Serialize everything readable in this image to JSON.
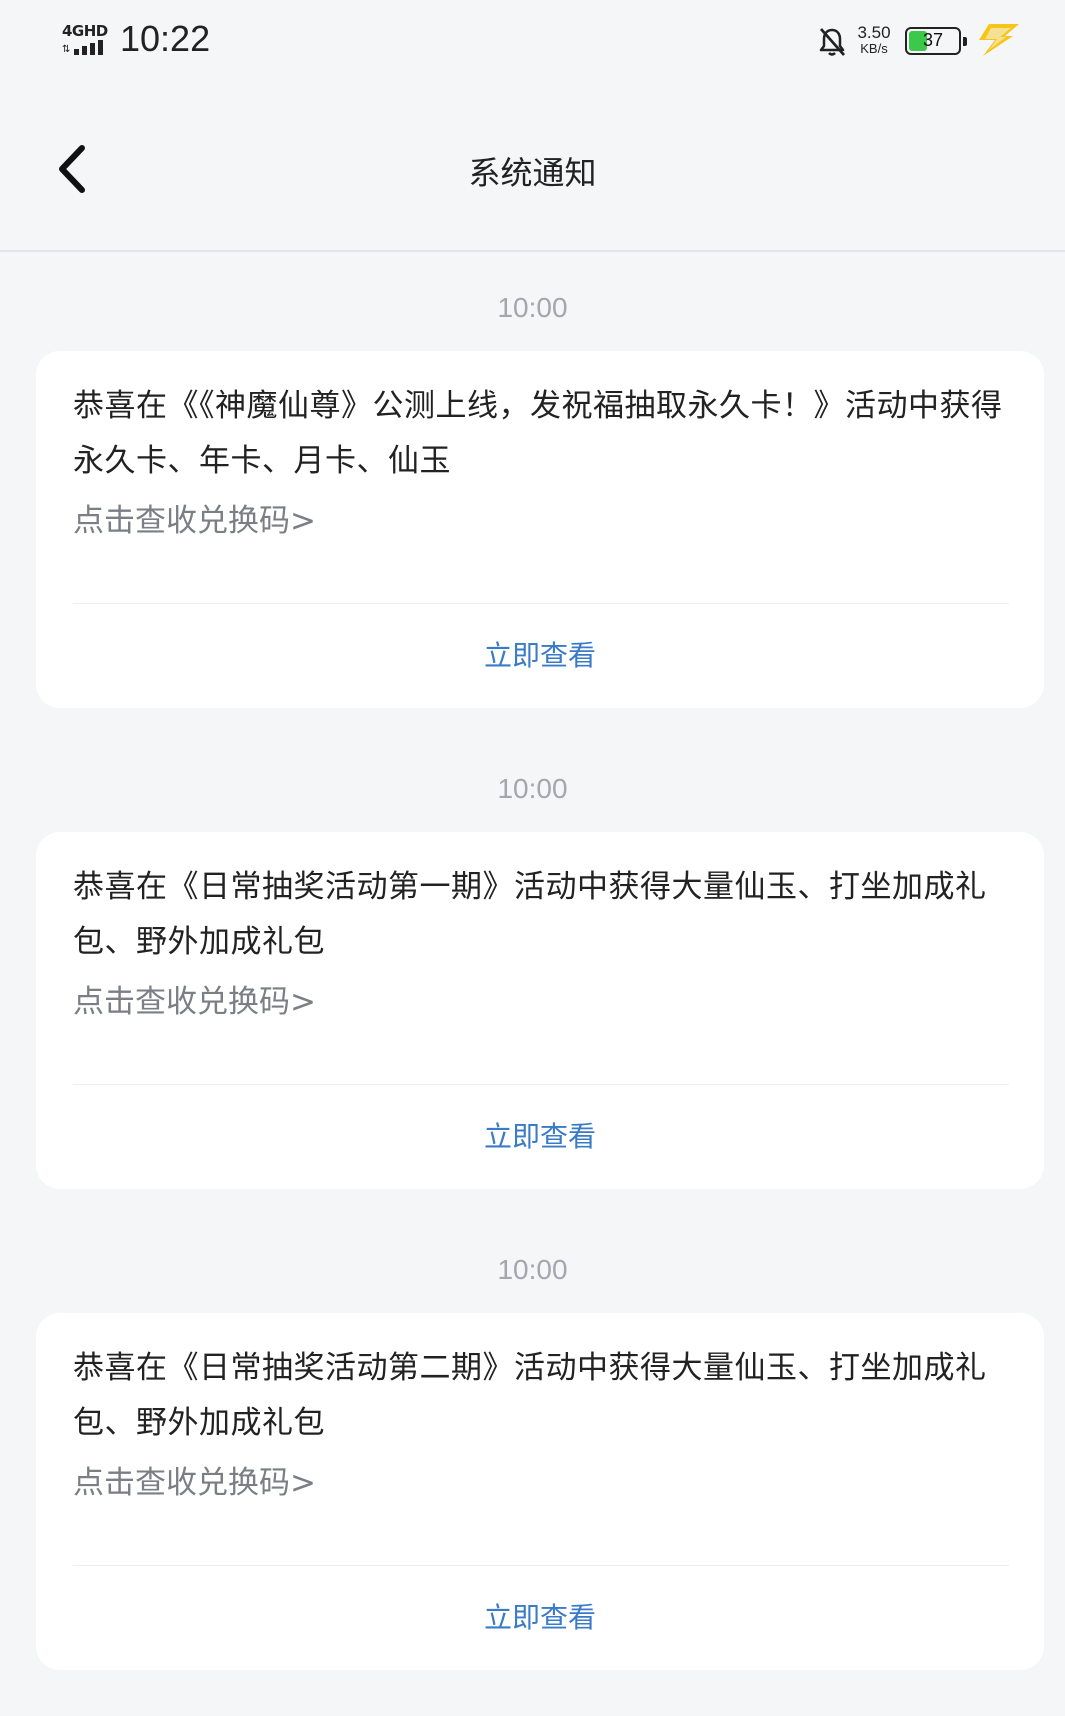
{
  "status_bar": {
    "network": "4GHD",
    "time": "10:22",
    "net_speed_value": "3.50",
    "net_speed_unit": "KB/s",
    "battery_level": "37",
    "battery_color": "#3cc84a",
    "charge_color": "#f5c518",
    "icons": [
      "signal-icon",
      "bell-off-icon",
      "battery-icon",
      "charging-icon"
    ]
  },
  "header": {
    "title": "系统通知",
    "back_icon": "chevron-left-icon"
  },
  "messages": [
    {
      "time": "10:00",
      "text": "恭喜在《《神魔仙尊》公测上线，发祝福抽取永久卡！》活动中获得永久卡、年卡、月卡、仙玉",
      "link": "点击查收兑换码>",
      "action": "立即查看"
    },
    {
      "time": "10:00",
      "text": "恭喜在《日常抽奖活动第一期》活动中获得大量仙玉、打坐加成礼包、野外加成礼包",
      "link": "点击查收兑换码>",
      "action": "立即查看"
    },
    {
      "time": "10:00",
      "text": "恭喜在《日常抽奖活动第二期》活动中获得大量仙玉、打坐加成礼包、野外加成礼包",
      "link": "点击查收兑换码>",
      "action": "立即查看"
    }
  ],
  "colors": {
    "background": "#f5f6f8",
    "card": "#ffffff",
    "accent": "#3a7bc8",
    "muted": "#a3a6ad"
  }
}
